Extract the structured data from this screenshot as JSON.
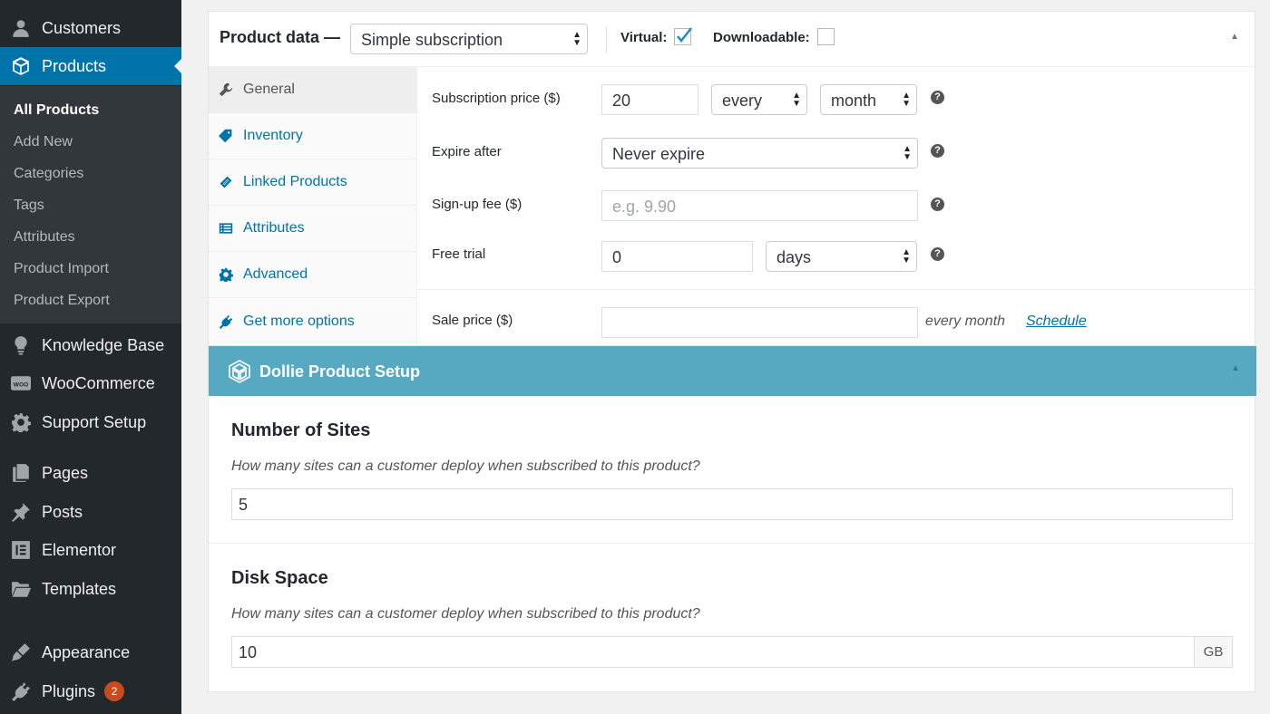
{
  "sidebar": {
    "menu": [
      {
        "label": "Customers",
        "icon": "user-icon"
      },
      {
        "label": "Products",
        "icon": "box-icon"
      },
      {
        "label": "Knowledge Base",
        "icon": "lightbulb-icon"
      },
      {
        "label": "WooCommerce",
        "icon": "woo-icon"
      },
      {
        "label": "Support Setup",
        "icon": "gear-icon"
      },
      {
        "label": "Pages",
        "icon": "pages-icon"
      },
      {
        "label": "Posts",
        "icon": "pin-icon"
      },
      {
        "label": "Elementor",
        "icon": "elementor-icon"
      },
      {
        "label": "Templates",
        "icon": "folder-icon"
      },
      {
        "label": "Appearance",
        "icon": "brush-icon"
      },
      {
        "label": "Plugins",
        "icon": "plugin-icon",
        "badge": "2"
      }
    ],
    "submenu": [
      "All Products",
      "Add New",
      "Categories",
      "Tags",
      "Attributes",
      "Product Import",
      "Product Export"
    ]
  },
  "product_data": {
    "title": "Product data —",
    "type_value": "Simple subscription",
    "virtual_label": "Virtual:",
    "virtual_checked": true,
    "downloadable_label": "Downloadable:",
    "downloadable_checked": false,
    "tabs": [
      "General",
      "Inventory",
      "Linked Products",
      "Attributes",
      "Advanced",
      "Get more options"
    ],
    "fields": {
      "subscription_price_label": "Subscription price ($)",
      "subscription_price_value": "20",
      "interval_value": "every",
      "period_value": "month",
      "expire_label": "Expire after",
      "expire_value": "Never expire",
      "signup_label": "Sign-up fee ($)",
      "signup_placeholder": "e.g. 9.90",
      "trial_label": "Free trial",
      "trial_value": "0",
      "trial_period_value": "days",
      "sale_label": "Sale price ($)",
      "sale_value": "",
      "sale_suffix": "every month",
      "schedule_link": "Schedule",
      "help_glyph": "?"
    }
  },
  "dollie": {
    "title": "Dollie Product Setup",
    "sites_heading": "Number of Sites",
    "sites_desc": "How many sites can a customer deploy when subscribed to this product?",
    "sites_value": "5",
    "disk_heading": "Disk Space",
    "disk_desc": "How many sites can a customer deploy when subscribed to this product?",
    "disk_value": "10",
    "disk_unit": "GB"
  },
  "colors": {
    "sidebar": "#23282d",
    "accent": "#0073aa",
    "dollie_header": "#56a9c1",
    "badge": "#ca4a1f"
  }
}
